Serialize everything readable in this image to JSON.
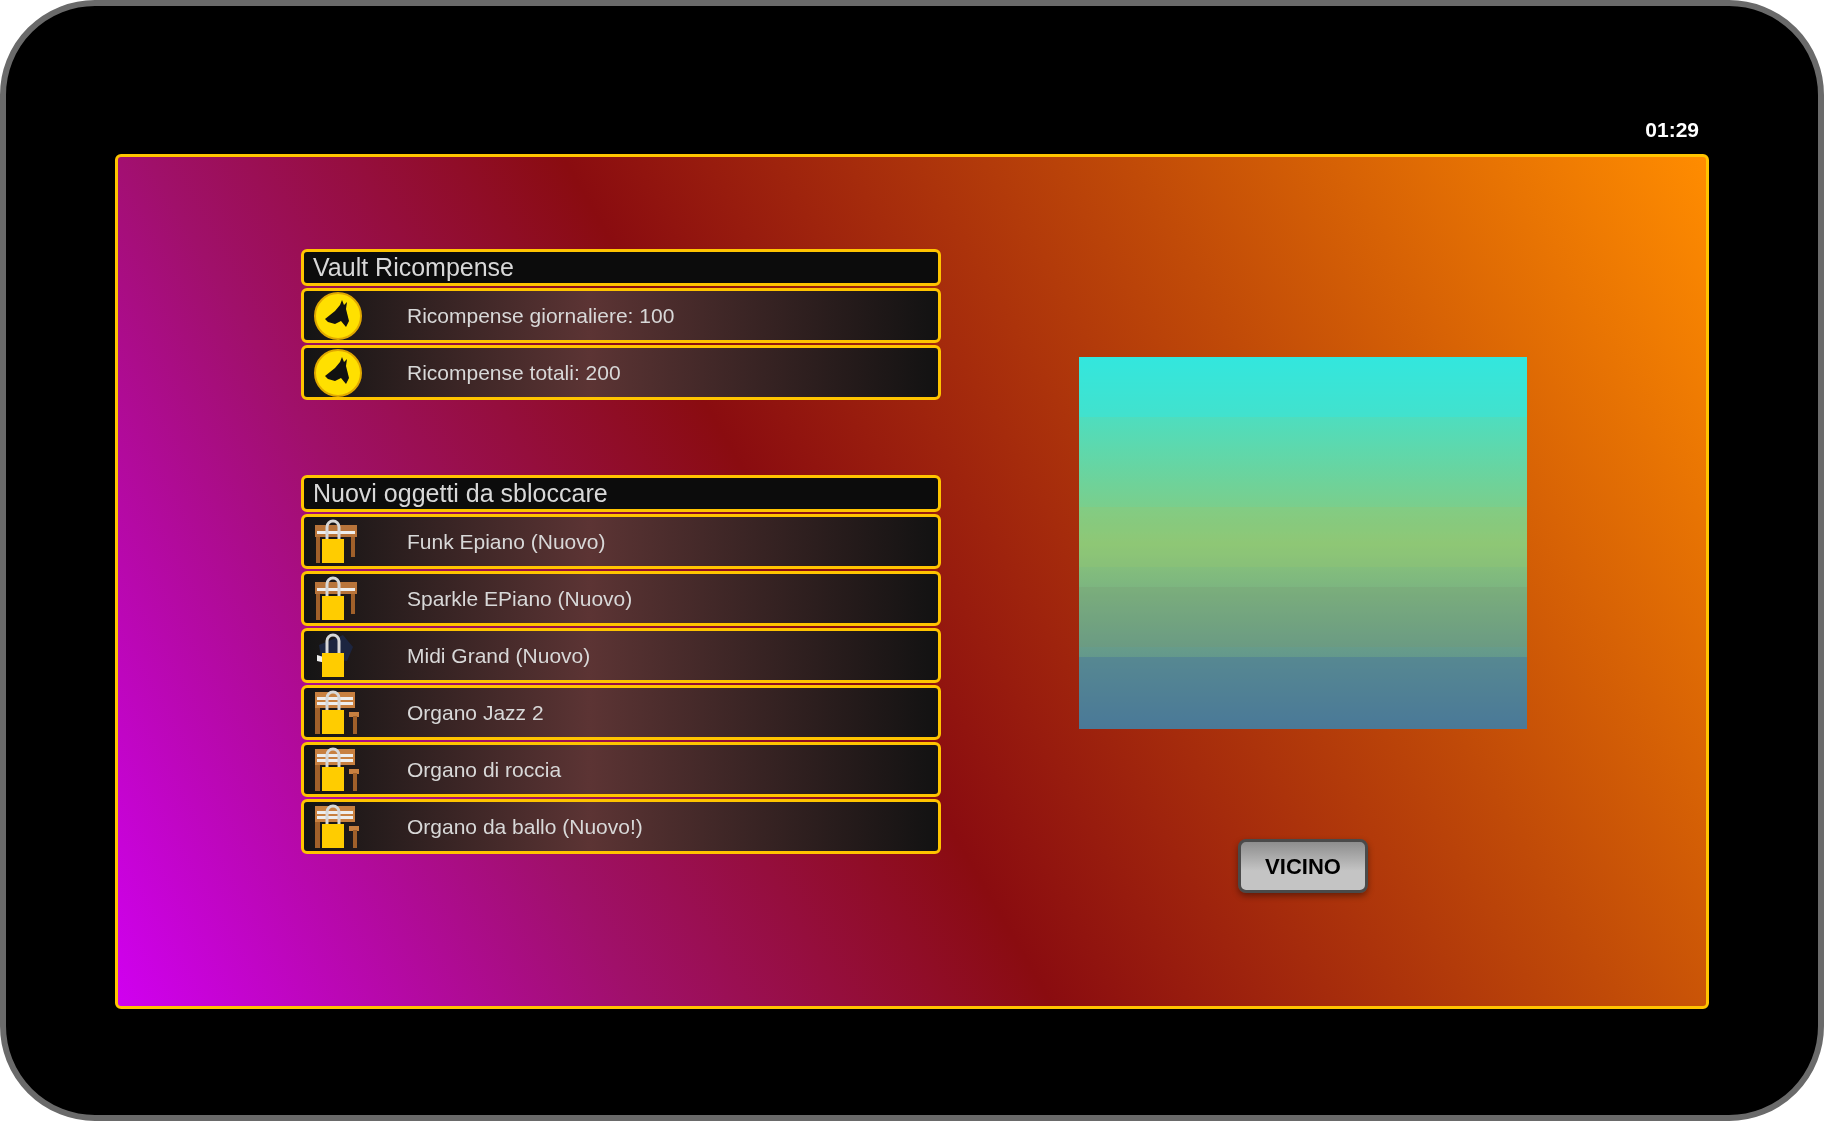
{
  "status_bar": {
    "time": "01:29"
  },
  "sections": [
    {
      "title": "Vault Ricompense",
      "items": [
        {
          "kind": "coin",
          "label": "Ricompense giornaliere: 100"
        },
        {
          "kind": "coin",
          "label": "Ricompense totali: 200"
        }
      ]
    },
    {
      "title": "Nuovi oggetti da sbloccare",
      "items": [
        {
          "kind": "upright",
          "label": "Funk Epiano (Nuovo)"
        },
        {
          "kind": "upright",
          "label": "Sparkle EPiano (Nuovo)"
        },
        {
          "kind": "grand",
          "label": "Midi Grand (Nuovo)"
        },
        {
          "kind": "organ",
          "label": "Organo Jazz 2"
        },
        {
          "kind": "organ",
          "label": "Organo di roccia"
        },
        {
          "kind": "organ",
          "label": "Organo da ballo (Nuovo!)"
        }
      ]
    }
  ],
  "close_button": {
    "label": "VICINO"
  }
}
